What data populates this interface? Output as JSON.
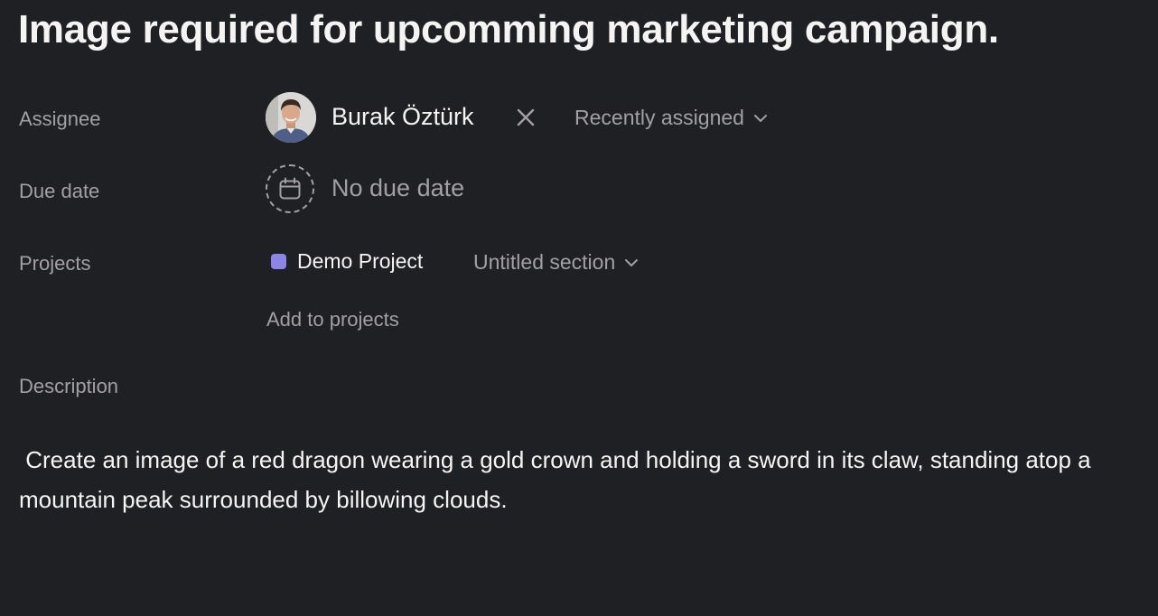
{
  "task": {
    "title": "Image required for upcomming marketing campaign."
  },
  "fields": {
    "assignee": {
      "label": "Assignee",
      "name": "Burak Öztürk",
      "remove_icon": "close-icon",
      "dropdown_label": "Recently assigned",
      "dropdown_icon": "chevron-down-icon"
    },
    "due_date": {
      "label": "Due date",
      "value": "No due date",
      "icon": "calendar-icon"
    },
    "projects": {
      "label": "Projects",
      "items": [
        {
          "name": "Demo Project",
          "color": "#8d84e8",
          "section": "Untitled section"
        }
      ],
      "add_label": "Add to projects"
    },
    "description": {
      "label": "Description",
      "text": " Create an image of a red dragon wearing a gold crown and holding a sword in its claw, standing atop a mountain peak surrounded by billowing clouds."
    }
  },
  "colors": {
    "background": "#1f2023",
    "text_primary": "#f5f4f3",
    "text_secondary": "#a2a0a2",
    "project_accent": "#8d84e8"
  }
}
